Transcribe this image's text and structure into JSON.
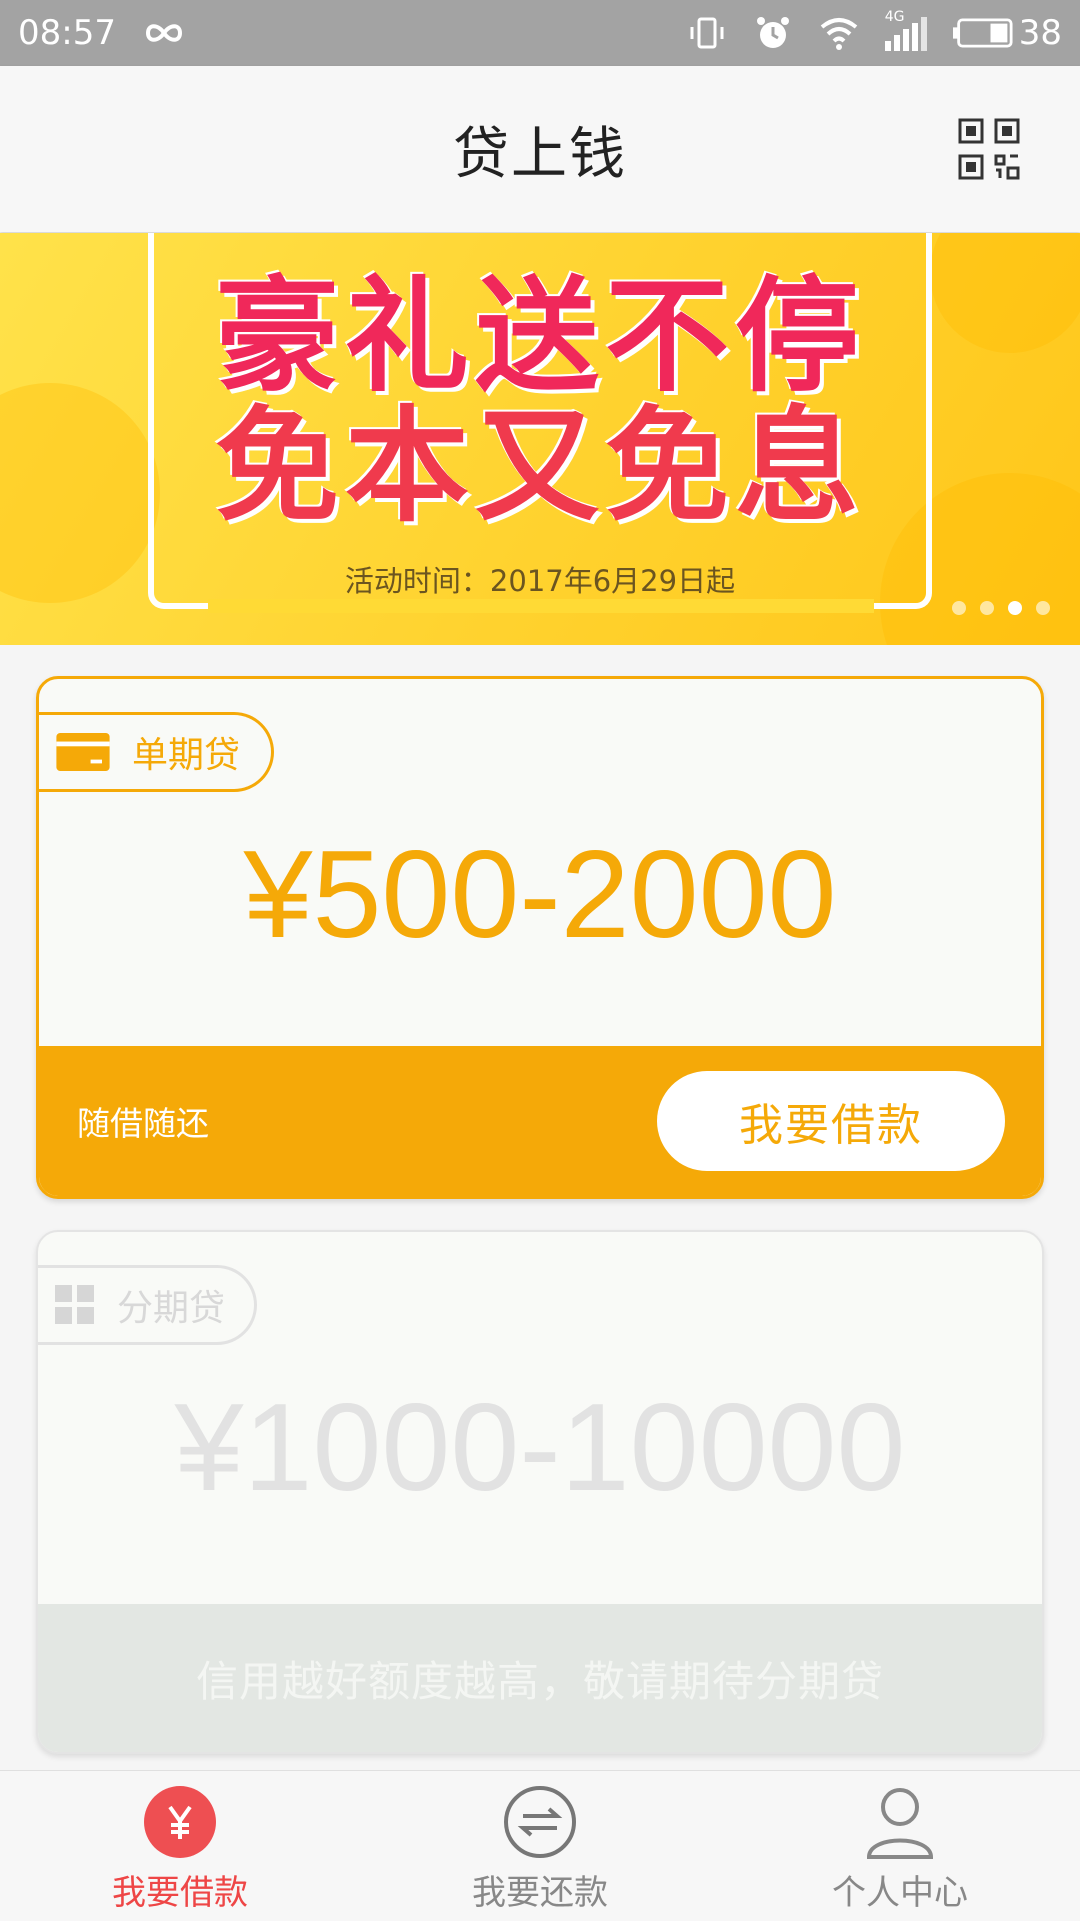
{
  "status_bar": {
    "time": "08:57",
    "network": "4G",
    "battery": "38"
  },
  "header": {
    "title": "贷上钱",
    "qr_icon": "qr-code-icon"
  },
  "banner": {
    "headline_1": "豪礼送不停",
    "headline_2": "免本又免息",
    "date_text": "活动时间：2017年6月29日起",
    "page_count": 4,
    "active_page": 3
  },
  "cards": [
    {
      "tag": "单期贷",
      "icon": "card-icon",
      "amount": "¥500-2000",
      "footer_note": "随借随还",
      "button_label": "我要借款",
      "enabled": true
    },
    {
      "tag": "分期贷",
      "icon": "grid-icon",
      "amount": "¥1000-10000",
      "footer_note": "信用越好额度越高，敬请期待分期贷",
      "enabled": false
    }
  ],
  "bottom_nav": {
    "items": [
      {
        "label": "我要借款",
        "icon": "yuan-icon",
        "active": true
      },
      {
        "label": "我要还款",
        "icon": "exchange-icon",
        "active": false
      },
      {
        "label": "个人中心",
        "icon": "person-icon",
        "active": false
      }
    ]
  },
  "colors": {
    "accent": "#f5a908",
    "active_nav": "#ee4646",
    "banner_text": "#f0285a",
    "disabled": "#e2e2e2"
  }
}
